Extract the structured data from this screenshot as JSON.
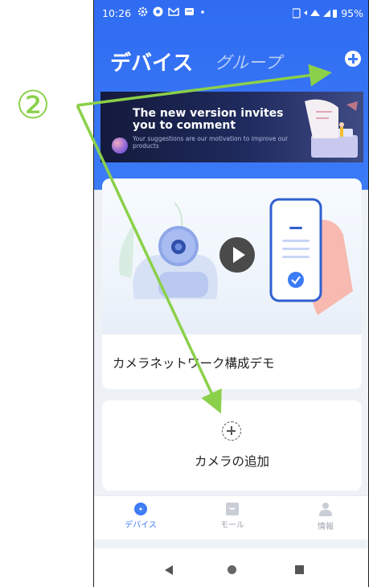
{
  "status_bar": {
    "time": "10:26",
    "battery": "95%"
  },
  "header": {
    "tab_devices": "デバイス",
    "tab_groups": "グループ"
  },
  "banner": {
    "title": "The new version invites you to comment",
    "subtitle": "Your suggestions are our motivation to improve our products"
  },
  "demo_card": {
    "label": "カメラネットワーク構成デモ"
  },
  "add_card": {
    "label": "カメラの追加"
  },
  "bottom_nav": {
    "devices": "デバイス",
    "mall": "モール",
    "info": "情報"
  },
  "annotation": {
    "step": "②",
    "arrow_color": "#8bd04a"
  },
  "colors": {
    "accent": "#3c7bf6"
  }
}
